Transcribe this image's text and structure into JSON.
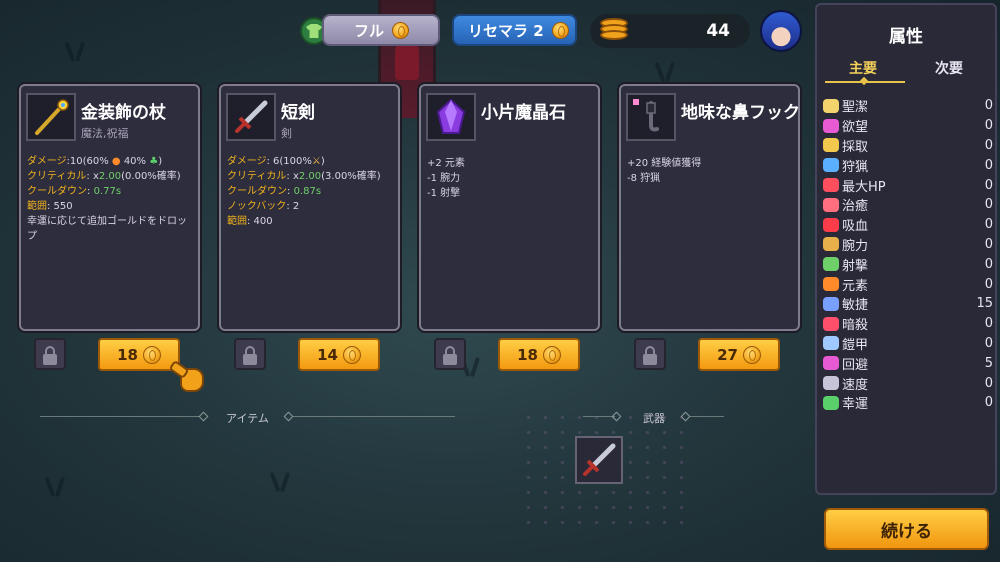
{
  "top_bar": {
    "full_label": "フル",
    "reroll_label": "リセマラ 2",
    "gold": "44"
  },
  "items": [
    {
      "name": "金装飾の杖",
      "subtitle": "魔法,祝福",
      "icon": "golden-staff-icon",
      "stats": [
        {
          "key": "ダメージ",
          "value": ":10(60% ",
          "extra": " 40% ",
          "tail": ")",
          "icons": [
            "fire-icon",
            "clover-icon"
          ]
        },
        {
          "key": "クリティカル",
          "pre": ": x",
          "green": "2.00",
          "post": "(0.00%確率)"
        },
        {
          "key": "クールダウン",
          "pre": ": ",
          "green": "0.77s",
          "post": ""
        },
        {
          "key": "範囲",
          "pre": ": 550",
          "green": "",
          "post": ""
        }
      ],
      "description": "幸運に応じて追加ゴールドをドロップ",
      "price": "18"
    },
    {
      "name": "短剣",
      "subtitle": "剣",
      "icon": "short-sword-icon",
      "stats": [
        {
          "key": "ダメージ",
          "value": ": 6(100%",
          "tail": ")",
          "icons": [
            "sword-icon"
          ]
        },
        {
          "key": "クリティカル",
          "pre": ": x",
          "green": "2.00",
          "post": "(3.00%確率)"
        },
        {
          "key": "クールダウン",
          "pre": ": ",
          "green": "0.87s",
          "post": ""
        },
        {
          "key": "ノックバック",
          "pre": ": 2",
          "green": "",
          "post": ""
        },
        {
          "key": "範囲",
          "pre": ": 400",
          "green": "",
          "post": ""
        }
      ],
      "price": "14"
    },
    {
      "name": "小片魔晶石",
      "subtitle": "",
      "icon": "purple-crystal-icon",
      "effects": [
        "+2 元素",
        "-1 腕力",
        "-1 射撃"
      ],
      "price": "18"
    },
    {
      "name": "地味な鼻フック",
      "subtitle": "",
      "icon": "nose-hook-icon",
      "effects": [
        "+20 経験値獲得",
        "-8 狩猟"
      ],
      "price": "27"
    }
  ],
  "sections": {
    "items_label": "アイテム",
    "weapons_label": "武器"
  },
  "side_panel": {
    "title": "属性",
    "tab_primary": "主要",
    "tab_secondary": "次要",
    "attributes": [
      {
        "name": "聖潔",
        "value": "0",
        "icon": "holy-icon",
        "color": "#f3d36b"
      },
      {
        "name": "欲望",
        "value": "0",
        "icon": "desire-heart-icon",
        "color": "#e85ad4"
      },
      {
        "name": "採取",
        "value": "0",
        "icon": "harvest-icon",
        "color": "#f2c94c"
      },
      {
        "name": "狩猟",
        "value": "0",
        "icon": "hunt-icon",
        "color": "#5ab0ff"
      },
      {
        "name": "最大HP",
        "value": "0",
        "icon": "heart-icon",
        "color": "#ff4f5e"
      },
      {
        "name": "治癒",
        "value": "0",
        "icon": "heal-icon",
        "color": "#ff6f7f"
      },
      {
        "name": "吸血",
        "value": "0",
        "icon": "blood-drop-icon",
        "color": "#ff3d4a"
      },
      {
        "name": "腕力",
        "value": "0",
        "icon": "strength-sword-icon",
        "color": "#e8b04a"
      },
      {
        "name": "射撃",
        "value": "0",
        "icon": "bow-icon",
        "color": "#6fd06a"
      },
      {
        "name": "元素",
        "value": "0",
        "icon": "fire-icon",
        "color": "#ff8a2a"
      },
      {
        "name": "敏捷",
        "value": "15",
        "icon": "agility-icon",
        "color": "#7aa0ff"
      },
      {
        "name": "暗殺",
        "value": "0",
        "icon": "assassin-icon",
        "color": "#ff4f6a"
      },
      {
        "name": "鎧甲",
        "value": "0",
        "icon": "armor-icon",
        "color": "#9ec8ff"
      },
      {
        "name": "回避",
        "value": "5",
        "icon": "dodge-icon",
        "color": "#e85ad4"
      },
      {
        "name": "速度",
        "value": "0",
        "icon": "speed-icon",
        "color": "#c8c4d8"
      },
      {
        "name": "幸運",
        "value": "0",
        "icon": "clover-icon",
        "color": "#5ad06a"
      }
    ]
  },
  "continue_label": "続ける"
}
